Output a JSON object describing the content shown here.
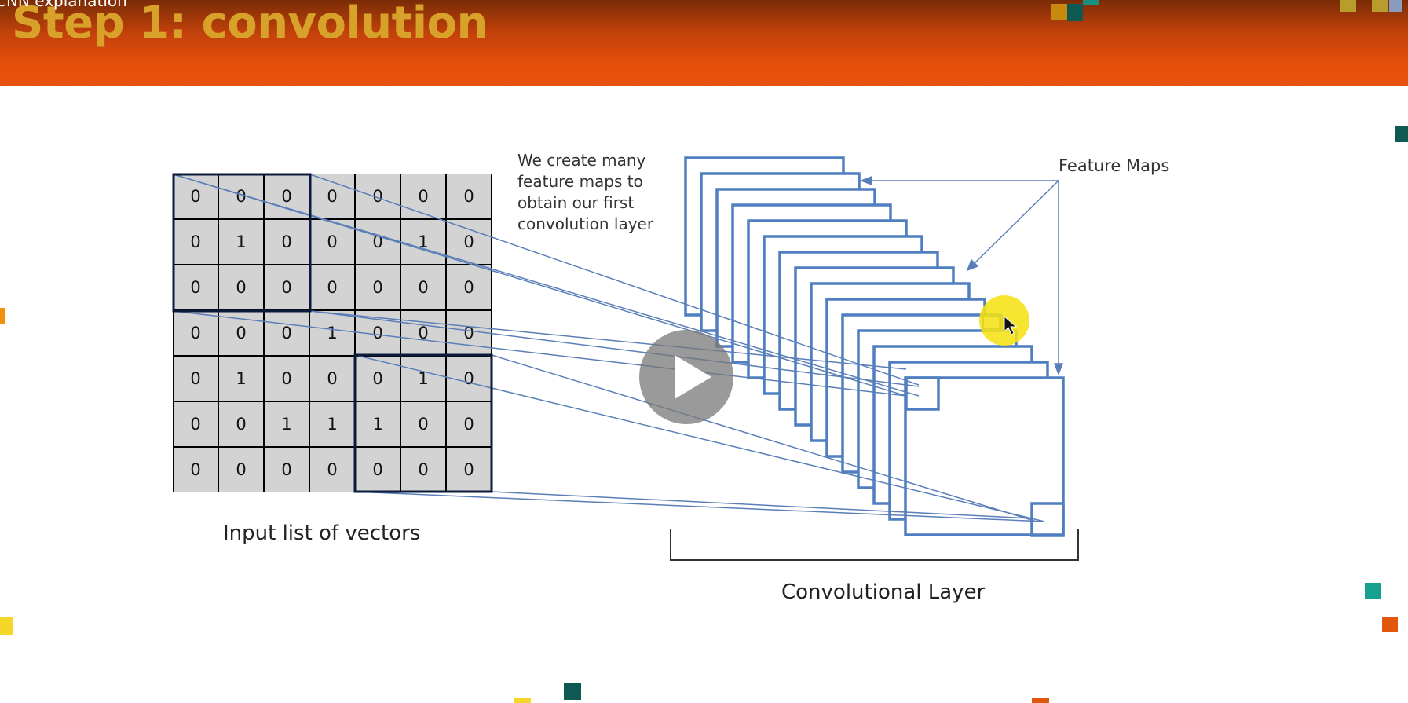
{
  "header": {
    "video_title": "CNN explanation",
    "slide_title": "Step 1: convolution"
  },
  "input_matrix": {
    "rows": [
      [
        "0",
        "0",
        "0",
        "0",
        "0",
        "0",
        "0"
      ],
      [
        "0",
        "1",
        "0",
        "0",
        "0",
        "1",
        "0"
      ],
      [
        "0",
        "0",
        "0",
        "0",
        "0",
        "0",
        "0"
      ],
      [
        "0",
        "0",
        "0",
        "1",
        "0",
        "0",
        "0"
      ],
      [
        "0",
        "1",
        "0",
        "0",
        "0",
        "1",
        "0"
      ],
      [
        "0",
        "0",
        "1",
        "1",
        "1",
        "0",
        "0"
      ],
      [
        "0",
        "0",
        "0",
        "0",
        "0",
        "0",
        "0"
      ]
    ],
    "caption": "Input list of vectors"
  },
  "annotation": {
    "lines": [
      "We create many",
      "feature maps to",
      "obtain our first",
      "convolution layer"
    ]
  },
  "feature_maps": {
    "label": "Feature Maps",
    "stack_count": 15
  },
  "conv_layer": {
    "caption": "Convolutional Layer"
  },
  "colors": {
    "header_orange": "#e8520b",
    "title_gold": "#d8a22a",
    "map_blue": "#4f7fc0",
    "line_blue": "#5a7fb8",
    "grid_gray": "#d3d3d3",
    "cursor_yellow": "#f5e114"
  },
  "player": {
    "play_icon": "play-icon",
    "cursor_icon": "mouse-pointer-icon"
  }
}
